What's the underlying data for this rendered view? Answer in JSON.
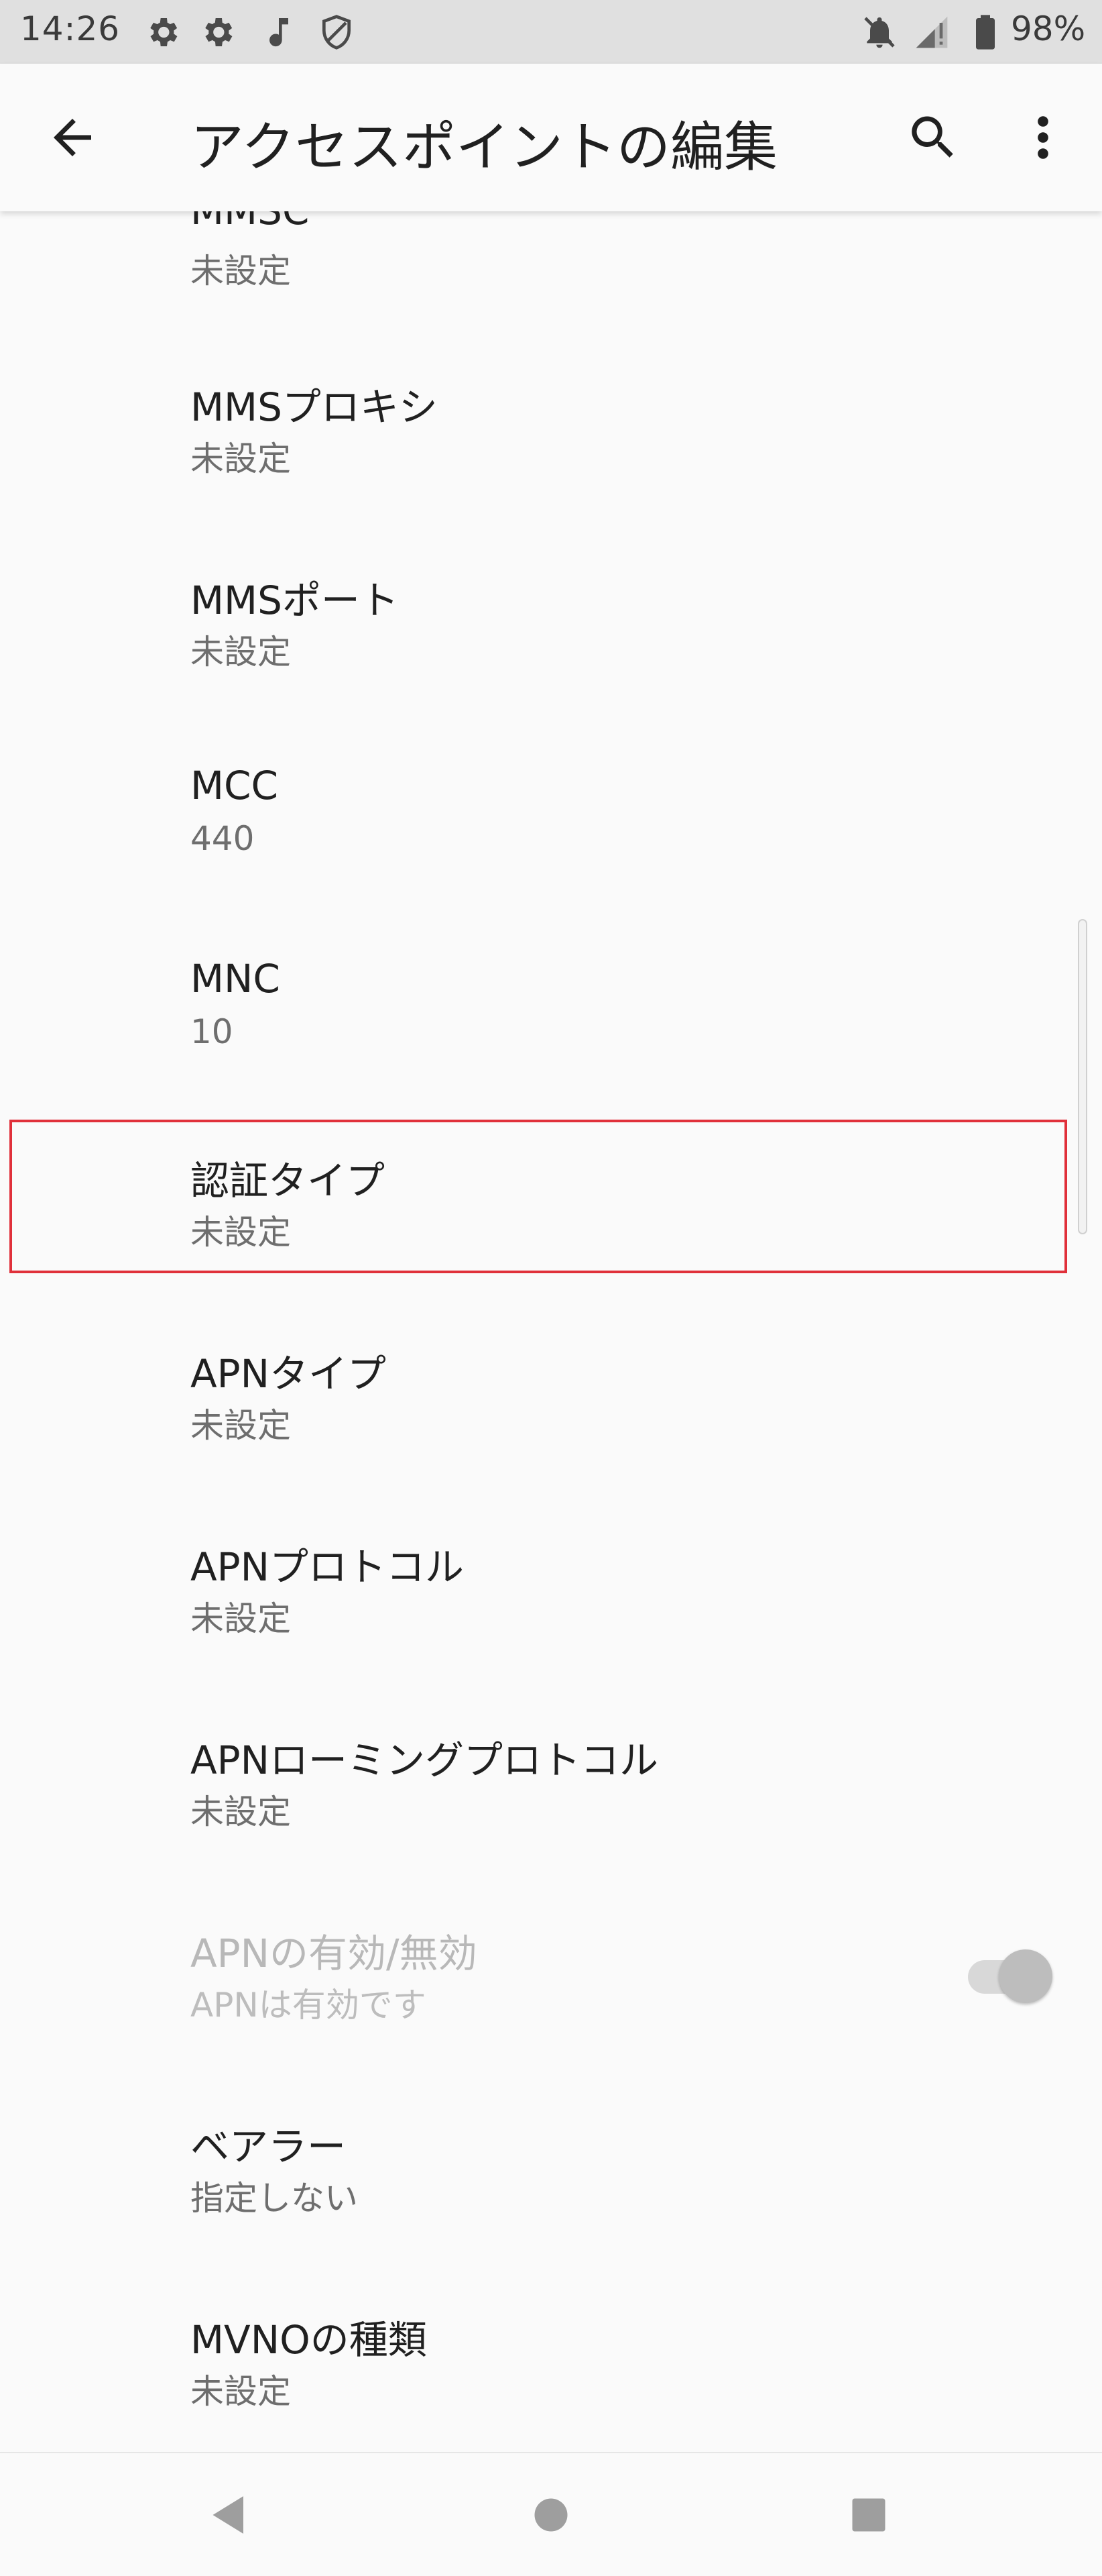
{
  "status_bar": {
    "time": "14:26",
    "battery_percent": "98%",
    "icons": [
      "settings-gear-icon",
      "settings-gear-icon",
      "music-note-icon",
      "shield-icon",
      "notifications-off-icon",
      "signal-icon",
      "battery-icon"
    ]
  },
  "app_bar": {
    "title": "アクセスポイントの編集",
    "back_icon": "arrow-back-icon",
    "search_icon": "search-icon",
    "more_icon": "more-vert-icon"
  },
  "list": {
    "items": [
      {
        "title": "MMSC",
        "summary": "未設定"
      },
      {
        "title": "MMSプロキシ",
        "summary": "未設定"
      },
      {
        "title": "MMSポート",
        "summary": "未設定"
      },
      {
        "title": "MCC",
        "summary": "440"
      },
      {
        "title": "MNC",
        "summary": "10"
      },
      {
        "title": "認証タイプ",
        "summary": "未設定"
      },
      {
        "title": "APNタイプ",
        "summary": "未設定"
      },
      {
        "title": "APNプロトコル",
        "summary": "未設定"
      },
      {
        "title": "APNローミングプロトコル",
        "summary": "未設定"
      },
      {
        "title": "APNの有効/無効",
        "summary": "APNは有効です",
        "toggle_on": true,
        "disabled": true
      },
      {
        "title": "ベアラー",
        "summary": "指定しない"
      },
      {
        "title": "MVNOの種類",
        "summary": "未設定"
      }
    ]
  },
  "colors": {
    "highlight": "#e0303a",
    "background": "#fafafa",
    "status_bar": "#e0e0e0"
  },
  "nav_bar": {
    "icons": [
      "nav-back-icon",
      "nav-home-icon",
      "nav-recents-icon"
    ]
  }
}
